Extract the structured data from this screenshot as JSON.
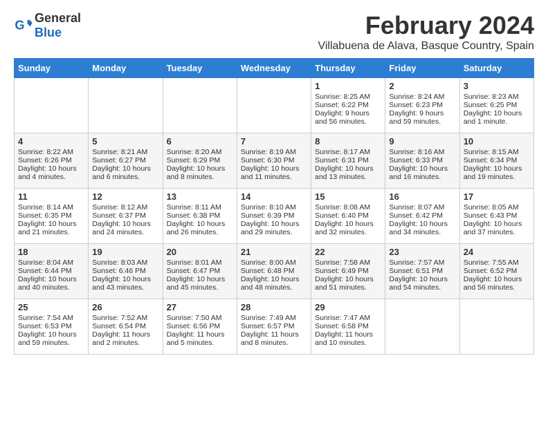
{
  "app": {
    "logo_general": "General",
    "logo_blue": "Blue"
  },
  "header": {
    "month": "February 2024",
    "location": "Villabuena de Alava, Basque Country, Spain"
  },
  "weekdays": [
    "Sunday",
    "Monday",
    "Tuesday",
    "Wednesday",
    "Thursday",
    "Friday",
    "Saturday"
  ],
  "weeks": [
    [
      {
        "day": "",
        "empty": true
      },
      {
        "day": "",
        "empty": true
      },
      {
        "day": "",
        "empty": true
      },
      {
        "day": "",
        "empty": true
      },
      {
        "day": "1",
        "sunrise": "Sunrise: 8:25 AM",
        "sunset": "Sunset: 6:22 PM",
        "daylight": "Daylight: 9 hours and 56 minutes."
      },
      {
        "day": "2",
        "sunrise": "Sunrise: 8:24 AM",
        "sunset": "Sunset: 6:23 PM",
        "daylight": "Daylight: 9 hours and 59 minutes."
      },
      {
        "day": "3",
        "sunrise": "Sunrise: 8:23 AM",
        "sunset": "Sunset: 6:25 PM",
        "daylight": "Daylight: 10 hours and 1 minute."
      }
    ],
    [
      {
        "day": "4",
        "sunrise": "Sunrise: 8:22 AM",
        "sunset": "Sunset: 6:26 PM",
        "daylight": "Daylight: 10 hours and 4 minutes."
      },
      {
        "day": "5",
        "sunrise": "Sunrise: 8:21 AM",
        "sunset": "Sunset: 6:27 PM",
        "daylight": "Daylight: 10 hours and 6 minutes."
      },
      {
        "day": "6",
        "sunrise": "Sunrise: 8:20 AM",
        "sunset": "Sunset: 6:29 PM",
        "daylight": "Daylight: 10 hours and 8 minutes."
      },
      {
        "day": "7",
        "sunrise": "Sunrise: 8:19 AM",
        "sunset": "Sunset: 6:30 PM",
        "daylight": "Daylight: 10 hours and 11 minutes."
      },
      {
        "day": "8",
        "sunrise": "Sunrise: 8:17 AM",
        "sunset": "Sunset: 6:31 PM",
        "daylight": "Daylight: 10 hours and 13 minutes."
      },
      {
        "day": "9",
        "sunrise": "Sunrise: 8:16 AM",
        "sunset": "Sunset: 6:33 PM",
        "daylight": "Daylight: 10 hours and 16 minutes."
      },
      {
        "day": "10",
        "sunrise": "Sunrise: 8:15 AM",
        "sunset": "Sunset: 6:34 PM",
        "daylight": "Daylight: 10 hours and 19 minutes."
      }
    ],
    [
      {
        "day": "11",
        "sunrise": "Sunrise: 8:14 AM",
        "sunset": "Sunset: 6:35 PM",
        "daylight": "Daylight: 10 hours and 21 minutes."
      },
      {
        "day": "12",
        "sunrise": "Sunrise: 8:12 AM",
        "sunset": "Sunset: 6:37 PM",
        "daylight": "Daylight: 10 hours and 24 minutes."
      },
      {
        "day": "13",
        "sunrise": "Sunrise: 8:11 AM",
        "sunset": "Sunset: 6:38 PM",
        "daylight": "Daylight: 10 hours and 26 minutes."
      },
      {
        "day": "14",
        "sunrise": "Sunrise: 8:10 AM",
        "sunset": "Sunset: 6:39 PM",
        "daylight": "Daylight: 10 hours and 29 minutes."
      },
      {
        "day": "15",
        "sunrise": "Sunrise: 8:08 AM",
        "sunset": "Sunset: 6:40 PM",
        "daylight": "Daylight: 10 hours and 32 minutes."
      },
      {
        "day": "16",
        "sunrise": "Sunrise: 8:07 AM",
        "sunset": "Sunset: 6:42 PM",
        "daylight": "Daylight: 10 hours and 34 minutes."
      },
      {
        "day": "17",
        "sunrise": "Sunrise: 8:05 AM",
        "sunset": "Sunset: 6:43 PM",
        "daylight": "Daylight: 10 hours and 37 minutes."
      }
    ],
    [
      {
        "day": "18",
        "sunrise": "Sunrise: 8:04 AM",
        "sunset": "Sunset: 6:44 PM",
        "daylight": "Daylight: 10 hours and 40 minutes."
      },
      {
        "day": "19",
        "sunrise": "Sunrise: 8:03 AM",
        "sunset": "Sunset: 6:46 PM",
        "daylight": "Daylight: 10 hours and 43 minutes."
      },
      {
        "day": "20",
        "sunrise": "Sunrise: 8:01 AM",
        "sunset": "Sunset: 6:47 PM",
        "daylight": "Daylight: 10 hours and 45 minutes."
      },
      {
        "day": "21",
        "sunrise": "Sunrise: 8:00 AM",
        "sunset": "Sunset: 6:48 PM",
        "daylight": "Daylight: 10 hours and 48 minutes."
      },
      {
        "day": "22",
        "sunrise": "Sunrise: 7:58 AM",
        "sunset": "Sunset: 6:49 PM",
        "daylight": "Daylight: 10 hours and 51 minutes."
      },
      {
        "day": "23",
        "sunrise": "Sunrise: 7:57 AM",
        "sunset": "Sunset: 6:51 PM",
        "daylight": "Daylight: 10 hours and 54 minutes."
      },
      {
        "day": "24",
        "sunrise": "Sunrise: 7:55 AM",
        "sunset": "Sunset: 6:52 PM",
        "daylight": "Daylight: 10 hours and 56 minutes."
      }
    ],
    [
      {
        "day": "25",
        "sunrise": "Sunrise: 7:54 AM",
        "sunset": "Sunset: 6:53 PM",
        "daylight": "Daylight: 10 hours and 59 minutes."
      },
      {
        "day": "26",
        "sunrise": "Sunrise: 7:52 AM",
        "sunset": "Sunset: 6:54 PM",
        "daylight": "Daylight: 11 hours and 2 minutes."
      },
      {
        "day": "27",
        "sunrise": "Sunrise: 7:50 AM",
        "sunset": "Sunset: 6:56 PM",
        "daylight": "Daylight: 11 hours and 5 minutes."
      },
      {
        "day": "28",
        "sunrise": "Sunrise: 7:49 AM",
        "sunset": "Sunset: 6:57 PM",
        "daylight": "Daylight: 11 hours and 8 minutes."
      },
      {
        "day": "29",
        "sunrise": "Sunrise: 7:47 AM",
        "sunset": "Sunset: 6:58 PM",
        "daylight": "Daylight: 11 hours and 10 minutes."
      },
      {
        "day": "",
        "empty": true
      },
      {
        "day": "",
        "empty": true
      }
    ]
  ]
}
